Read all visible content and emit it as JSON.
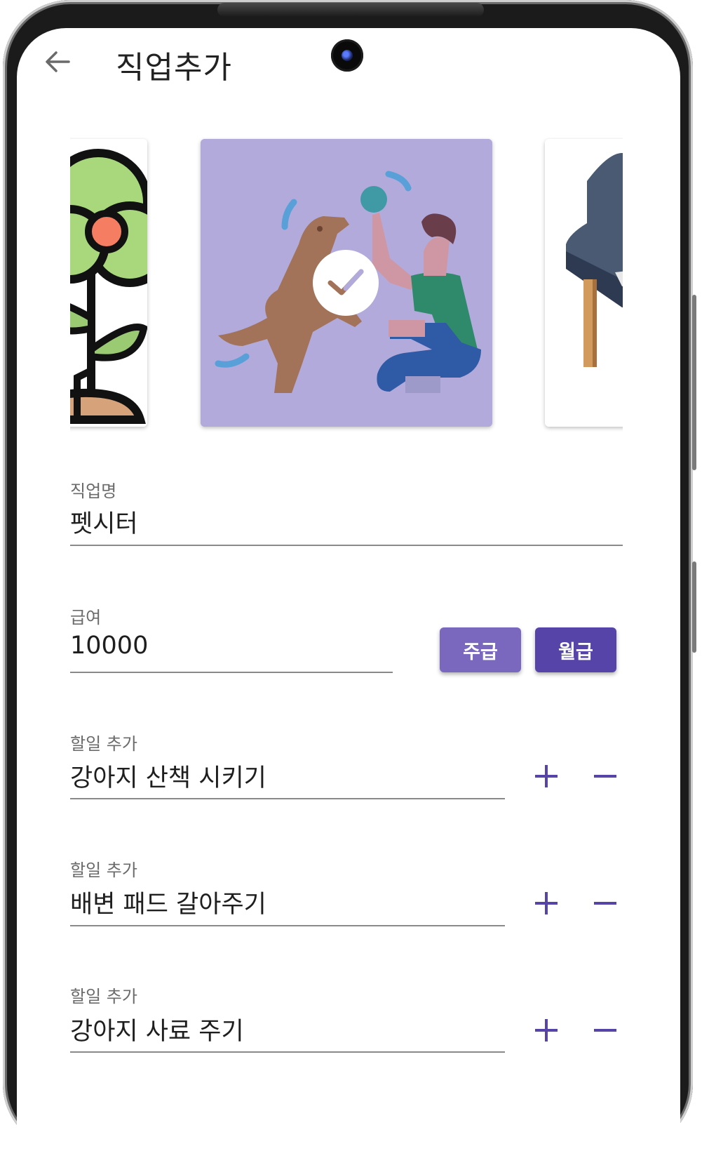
{
  "header": {
    "title": "직업추가"
  },
  "carousel": {
    "cards": [
      {
        "name": "gardener",
        "selected": false
      },
      {
        "name": "pet-sitter",
        "selected": true
      },
      {
        "name": "piano",
        "selected": false
      }
    ]
  },
  "form": {
    "job_name": {
      "label": "직업명",
      "value": "펫시터"
    },
    "salary": {
      "label": "급여",
      "value": "10000",
      "weekly_label": "주급",
      "monthly_label": "월급"
    },
    "todos": [
      {
        "label": "할일 추가",
        "value": "강아지 산책 시키기"
      },
      {
        "label": "할일 추가",
        "value": "배변 패드 갈아주기"
      },
      {
        "label": "할일 추가",
        "value": "강아지 사료 주기"
      }
    ]
  },
  "colors": {
    "accent": "#5644a8",
    "accent_light": "#7a68bf",
    "selected_card_bg": "#b2aadb"
  }
}
